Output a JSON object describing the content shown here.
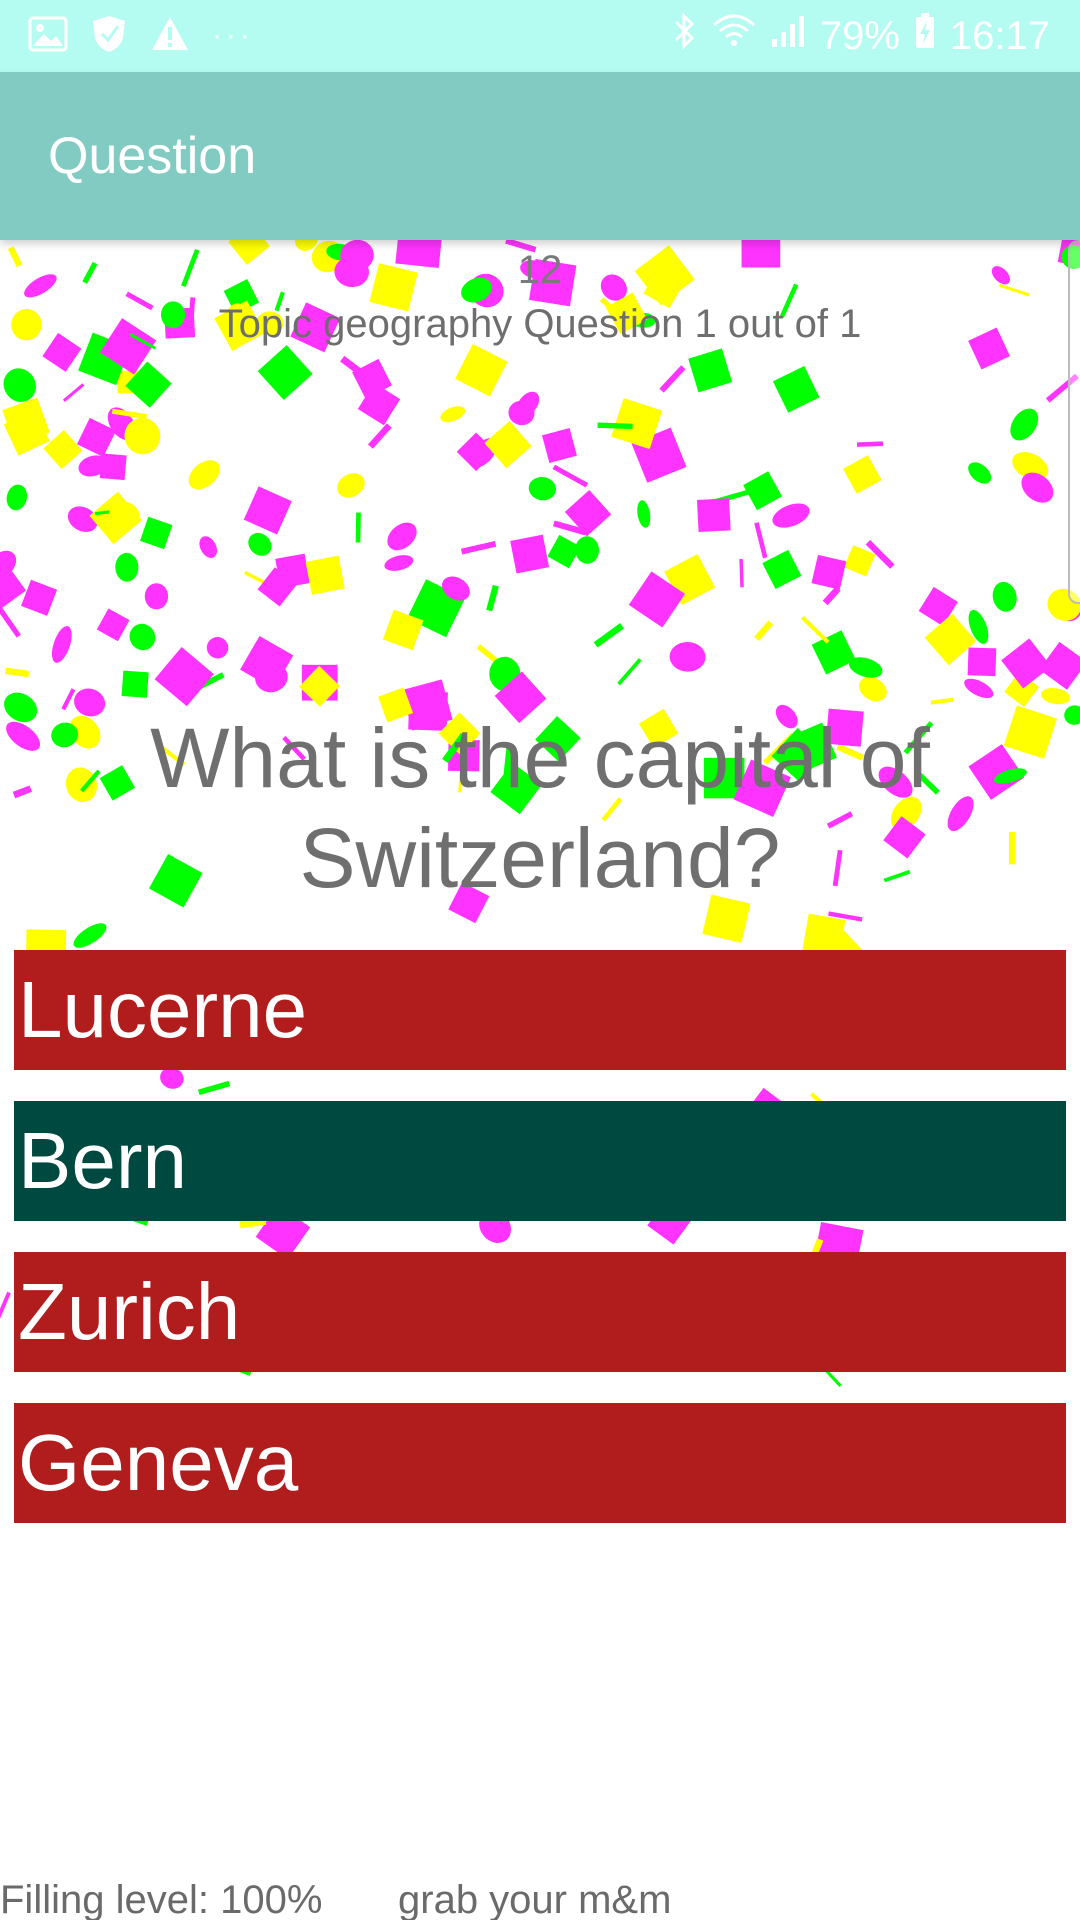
{
  "status_bar": {
    "left_icons": [
      "image-icon",
      "shield-icon",
      "warning-icon"
    ],
    "more_dots": "···",
    "battery_text": "79%",
    "time": "16:17",
    "right_icons": [
      "bluetooth-icon",
      "wifi-icon",
      "signal-icon",
      "battery-charging-icon"
    ]
  },
  "app_bar": {
    "title": "Question"
  },
  "quiz": {
    "timer": "12",
    "topic_line": "Topic geography Question 1 out of 1",
    "question": "What is the capital of Switzerland?",
    "answers": [
      {
        "label": "Lucerne",
        "state": "wrong"
      },
      {
        "label": "Bern",
        "state": "correct"
      },
      {
        "label": "Zurich",
        "state": "wrong"
      },
      {
        "label": "Geneva",
        "state": "wrong"
      }
    ]
  },
  "footer": {
    "filling_level": "Filling level: 100%",
    "grab_text": "grab your m&m"
  },
  "colors": {
    "status_bar": "#b4fcf1",
    "app_bar": "#81cbc2",
    "wrong_answer": "#b11c1c",
    "correct_answer": "#004940",
    "confetti": [
      "#ff33ff",
      "#ffff00",
      "#00ff00"
    ]
  }
}
